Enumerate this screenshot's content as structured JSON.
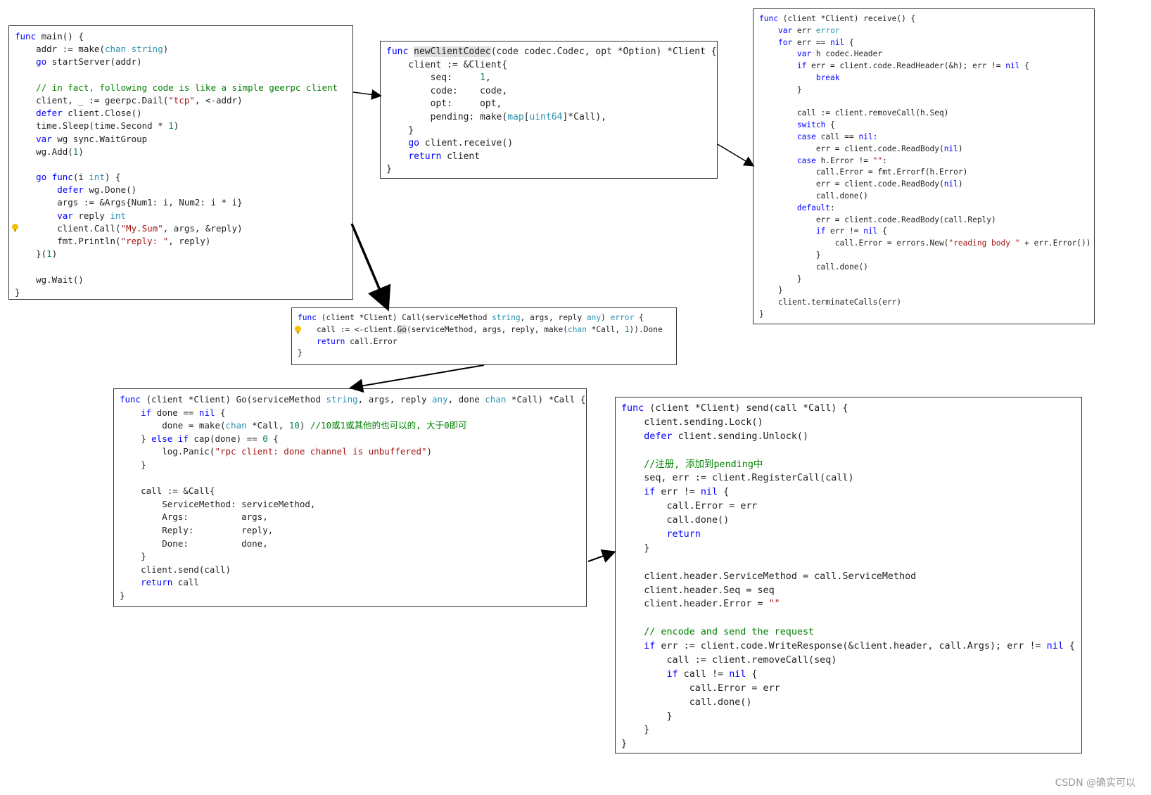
{
  "boxes": {
    "main": [
      "func main() {",
      "    addr := make(chan string)",
      "    go startServer(addr)",
      "",
      "    // in fact, following code is like a simple geerpc client",
      "    client, _ := geerpc.Dail(\"tcp\", <-addr)",
      "    defer client.Close()",
      "    time.Sleep(time.Second * 1)",
      "    var wg sync.WaitGroup",
      "    wg.Add(1)",
      "",
      "    go func(i int) {",
      "        defer wg.Done()",
      "        args := &Args{Num1: i, Num2: i * i}",
      "        var reply int",
      "        client.Call(\"My.Sum\", args, &reply)",
      "        fmt.Println(\"reply: \", reply)",
      "    }(1)",
      "",
      "    wg.Wait()",
      "}"
    ],
    "codec": [
      "func newClientCodec(code codec.Codec, opt *Option) *Client {",
      "    client := &Client{",
      "        seq:     1,",
      "        code:    code,",
      "        opt:     opt,",
      "        pending: make(map[uint64]*Call),",
      "    }",
      "    go client.receive()",
      "    return client",
      "}"
    ],
    "receive": [
      "func (client *Client) receive() {",
      "    var err error",
      "    for err == nil {",
      "        var h codec.Header",
      "        if err = client.code.ReadHeader(&h); err != nil {",
      "            break",
      "        }",
      "",
      "        call := client.removeCall(h.Seq)",
      "        switch {",
      "        case call == nil:",
      "            err = client.code.ReadBody(nil)",
      "        case h.Error != \"\":",
      "            call.Error = fmt.Errorf(h.Error)",
      "            err = client.code.ReadBody(nil)",
      "            call.done()",
      "        default:",
      "            err = client.code.ReadBody(call.Reply)",
      "            if err != nil {",
      "                call.Error = errors.New(\"reading body \" + err.Error())",
      "            }",
      "            call.done()",
      "        }",
      "    }",
      "    client.terminateCalls(err)",
      "}"
    ],
    "call": [
      "func (client *Client) Call(serviceMethod string, args, reply any) error {",
      "    call := <-client.Go(serviceMethod, args, reply, make(chan *Call, 1)).Done",
      "    return call.Error",
      "}"
    ],
    "go": [
      "func (client *Client) Go(serviceMethod string, args, reply any, done chan *Call) *Call {",
      "    if done == nil {",
      "        done = make(chan *Call, 10) //10或1或其他的也可以的, 大于0即可",
      "    } else if cap(done) == 0 {",
      "        log.Panic(\"rpc client: done channel is unbuffered\")",
      "    }",
      "",
      "    call := &Call{",
      "        ServiceMethod: serviceMethod,",
      "        Args:          args,",
      "        Reply:         reply,",
      "        Done:          done,",
      "    }",
      "    client.send(call)",
      "    return call",
      "}"
    ],
    "send": [
      "func (client *Client) send(call *Call) {",
      "    client.sending.Lock()",
      "    defer client.sending.Unlock()",
      "",
      "    //注册, 添加到pending中",
      "    seq, err := client.RegisterCall(call)",
      "    if err != nil {",
      "        call.Error = err",
      "        call.done()",
      "        return",
      "    }",
      "",
      "    client.header.ServiceMethod = call.ServiceMethod",
      "    client.header.Seq = seq",
      "    client.header.Error = \"\"",
      "",
      "    // encode and send the request",
      "    if err := client.code.WriteResponse(&client.header, call.Args); err != nil {",
      "        call := client.removeCall(seq)",
      "        if call != nil {",
      "            call.Error = err",
      "            call.done()",
      "        }",
      "    }",
      "}"
    ]
  },
  "watermark": "CSDN @确实可以",
  "colors": {
    "keyword": "#0000ff",
    "type": "#2b91af",
    "string": "#a31515",
    "comment": "#008000",
    "number": "#098658"
  }
}
